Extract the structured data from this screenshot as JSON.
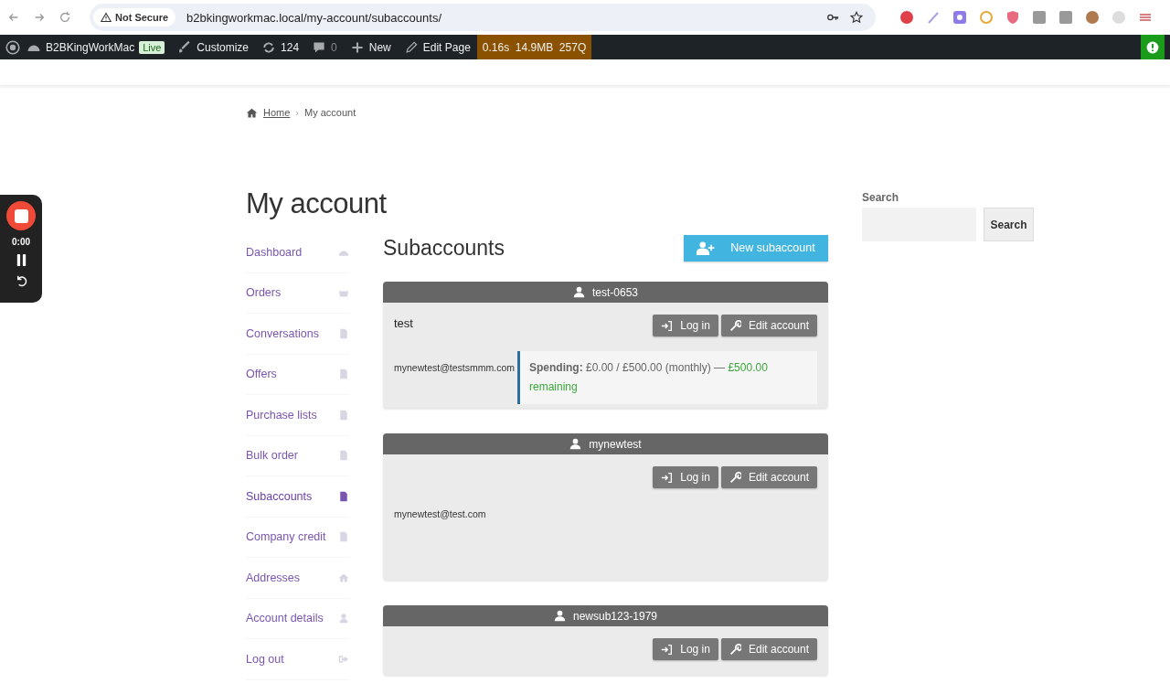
{
  "browser": {
    "security": "Not Secure",
    "url": "b2bkingworkmac.local/my-account/subaccounts/"
  },
  "admin_bar": {
    "site": "B2BKingWorkMac",
    "badge": "Live",
    "customize": "Customize",
    "updates": "124",
    "comments": "0",
    "new": "New",
    "edit": "Edit Page",
    "perf": "0.16s  14.9MB  257Q"
  },
  "recorder": {
    "time": "0:00"
  },
  "breadcrumb": {
    "home": "Home",
    "separator": "›",
    "current": "My account"
  },
  "page_title": "My account",
  "nav": [
    {
      "label": "Dashboard",
      "kind": "gauge",
      "selected": false
    },
    {
      "label": "Orders",
      "kind": "basket",
      "selected": false
    },
    {
      "label": "Conversations",
      "kind": "file",
      "selected": false
    },
    {
      "label": "Offers",
      "kind": "file",
      "selected": false
    },
    {
      "label": "Purchase lists",
      "kind": "file",
      "selected": false
    },
    {
      "label": "Bulk order",
      "kind": "file",
      "selected": false
    },
    {
      "label": "Subaccounts",
      "kind": "file",
      "selected": true
    },
    {
      "label": "Company credit",
      "kind": "file",
      "selected": false
    },
    {
      "label": "Addresses",
      "kind": "home",
      "selected": false
    },
    {
      "label": "Account details",
      "kind": "user",
      "selected": false
    },
    {
      "label": "Log out",
      "kind": "exit",
      "selected": false
    }
  ],
  "subaccounts": {
    "title": "Subaccounts",
    "new_button": "New subaccount"
  },
  "accounts": [
    {
      "username": "test-0653",
      "name": "test",
      "login_button": "Log in",
      "edit_button": "Edit account",
      "email": "mynewtest@testsmmm.com",
      "spending": {
        "label": "Spending:",
        "amount": "£0.00 / £500.00 (monthly) —",
        "remaining": "£500.00 remaining"
      }
    },
    {
      "username": "mynewtest",
      "login_button": "Log in",
      "edit_button": "Edit account",
      "email": "mynewtest@test.com"
    },
    {
      "username": "newsub123-1979",
      "login_button": "Log in",
      "edit_button": "Edit account"
    }
  ],
  "search": {
    "label": "Search",
    "button": "Search"
  }
}
